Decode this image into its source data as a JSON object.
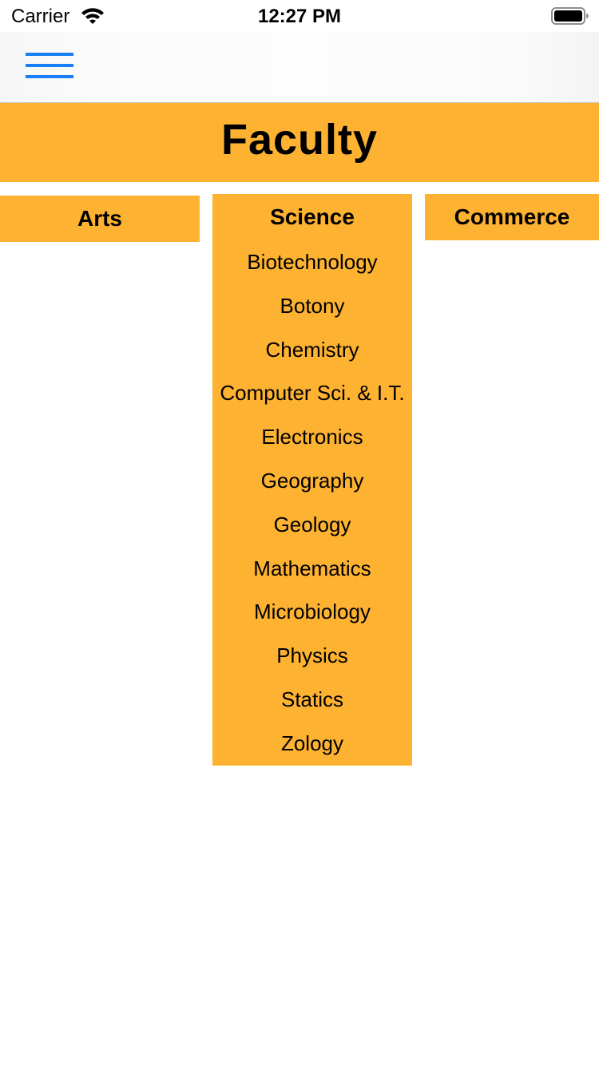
{
  "status_bar": {
    "carrier": "Carrier",
    "time": "12:27 PM",
    "icons": [
      "wifi-icon",
      "battery-icon"
    ]
  },
  "nav": {
    "menu_icon": "hamburger-menu-icon",
    "accent_color": "#1a7ef5"
  },
  "header": {
    "title": "Faculty",
    "background_color": "#fdb232"
  },
  "faculties": {
    "arts": {
      "title": "Arts",
      "departments": []
    },
    "science": {
      "title": "Science",
      "departments": [
        "Biotechnology",
        "Botony",
        "Chemistry",
        "Computer Sci. & I.T.",
        "Electronics",
        "Geography",
        "Geology",
        "Mathematics",
        "Microbiology",
        "Physics",
        "Statics",
        "Zology"
      ]
    },
    "commerce": {
      "title": "Commerce",
      "departments": []
    }
  }
}
